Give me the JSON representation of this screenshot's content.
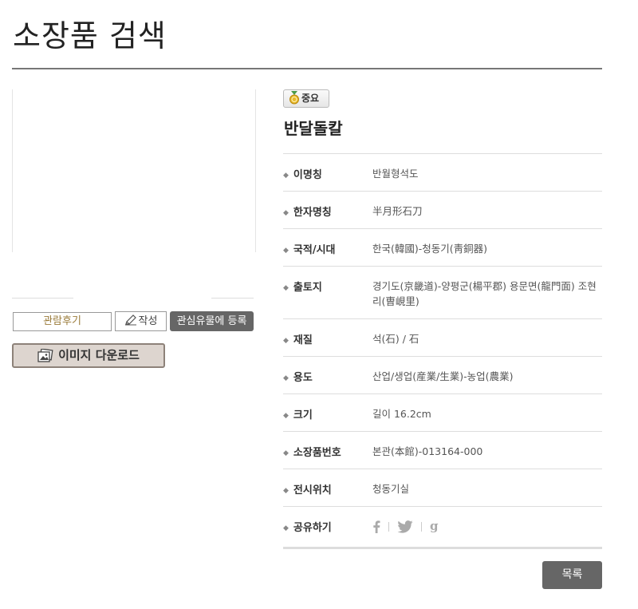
{
  "page": {
    "title": "소장품 검색"
  },
  "actions": {
    "review_label": "관람후기",
    "write_label": "작성",
    "favorite_label": "관심유물에 등록",
    "download_label": "이미지 다운로드",
    "list_label": "목록"
  },
  "item": {
    "badge": "중요",
    "title": "반달돌칼",
    "fields": [
      {
        "label": "이명칭",
        "value": "반월형석도"
      },
      {
        "label": "한자명칭",
        "value": "半月形石刀"
      },
      {
        "label": "국적/시대",
        "value": "한국(韓國)-청동기(靑銅器)"
      },
      {
        "label": "출토지",
        "value": "경기도(京畿道)-양평군(楊平郡) 용문면(龍門面) 조현리(曺峴里)"
      },
      {
        "label": "재질",
        "value": "석(石) / 石"
      },
      {
        "label": "용도",
        "value": "산업/생업(産業/生業)-농업(農業)"
      },
      {
        "label": "크기",
        "value": "길이 16.2cm"
      },
      {
        "label": "소장품번호",
        "value": "본관(本館)-013164-000"
      },
      {
        "label": "전시위치",
        "value": "청동기실"
      },
      {
        "label": "공유하기",
        "value": ""
      }
    ],
    "share_icons": [
      "facebook-icon",
      "twitter-icon",
      "google-plus-icon"
    ]
  },
  "colors": {
    "rule": "#777777",
    "button_dark": "#666666",
    "download_bg": "#ddd5cf",
    "review_text": "#9a7b3a"
  }
}
